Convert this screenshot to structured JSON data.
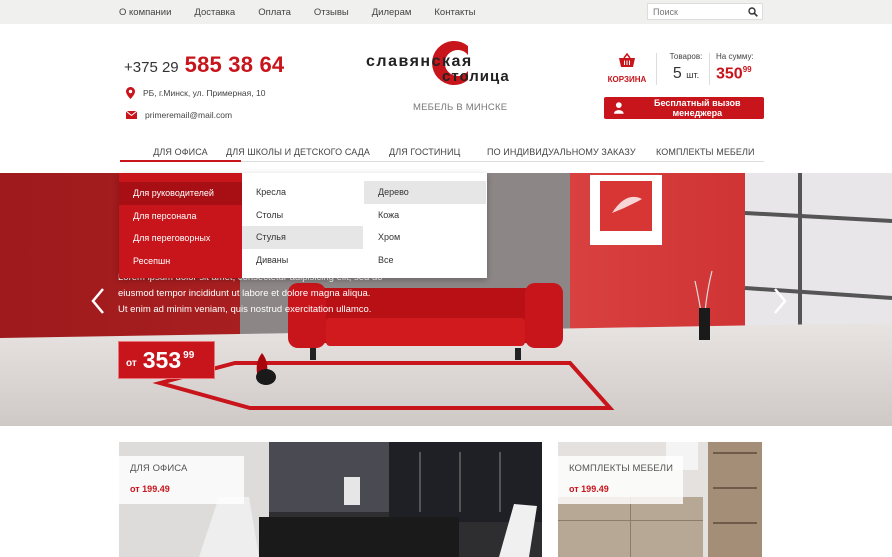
{
  "topnav": [
    "О компании",
    "Доставка",
    "Оплата",
    "Отзывы",
    "Дилерам",
    "Контакты"
  ],
  "search": {
    "placeholder": "Поиск"
  },
  "header": {
    "phone_code": "+375 29",
    "phone_number": "585 38 64",
    "address": "РБ, г.Минск, ул. Примерная, 10",
    "email": "primeremail@mail.com",
    "logo_top": "славянская",
    "logo_bottom": "столица",
    "logo_sub": "МЕБЕЛЬ В МИНСКЕ",
    "cart_label": "КОРЗИНА",
    "goods_label": "Товаров:",
    "goods_count": "5",
    "goods_unit": "шт.",
    "sum_label": "На сумму:",
    "sum_value": "350",
    "sum_cents": "99",
    "manager_button": "Бесплатный вызов менеджера"
  },
  "mainnav": [
    "ДЛЯ ОФИСА",
    "ДЛЯ ШКОЛЫ И ДЕТСКОГО САДА",
    "ДЛЯ ГОСТИНИЦ",
    "ПО ИНДИВИДУАЛЬНОМУ ЗАКАЗУ",
    "КОМПЛЕКТЫ МЕБЕЛИ"
  ],
  "dropdown": {
    "col1": [
      "Для руководителей",
      "Для персонала",
      "Для переговорных",
      "Ресепшн"
    ],
    "col2": [
      "Кресла",
      "Столы",
      "Стулья",
      "Диваны"
    ],
    "col3": [
      "Дерево",
      "Кожа",
      "Хром",
      "Все"
    ]
  },
  "hero": {
    "line1": "Lorem ipsum dolor sit amet, consectetur adipisicing elit, sed do",
    "line2": "eiusmod tempor incididunt ut labore et dolore magna aliqua.",
    "line3": "Ut enim ad minim veniam, quis nostrud exercitation ullamco.",
    "price_prefix": "от",
    "price": "353",
    "price_cents": "99"
  },
  "cards": [
    {
      "title": "ДЛЯ ОФИСА",
      "price": "от 199.49"
    },
    {
      "title": "КОМПЛЕКТЫ МЕБЕЛИ",
      "price": "от 199.49"
    }
  ],
  "colors": {
    "accent": "#c8141b",
    "topbar": "#f0f0ee"
  }
}
